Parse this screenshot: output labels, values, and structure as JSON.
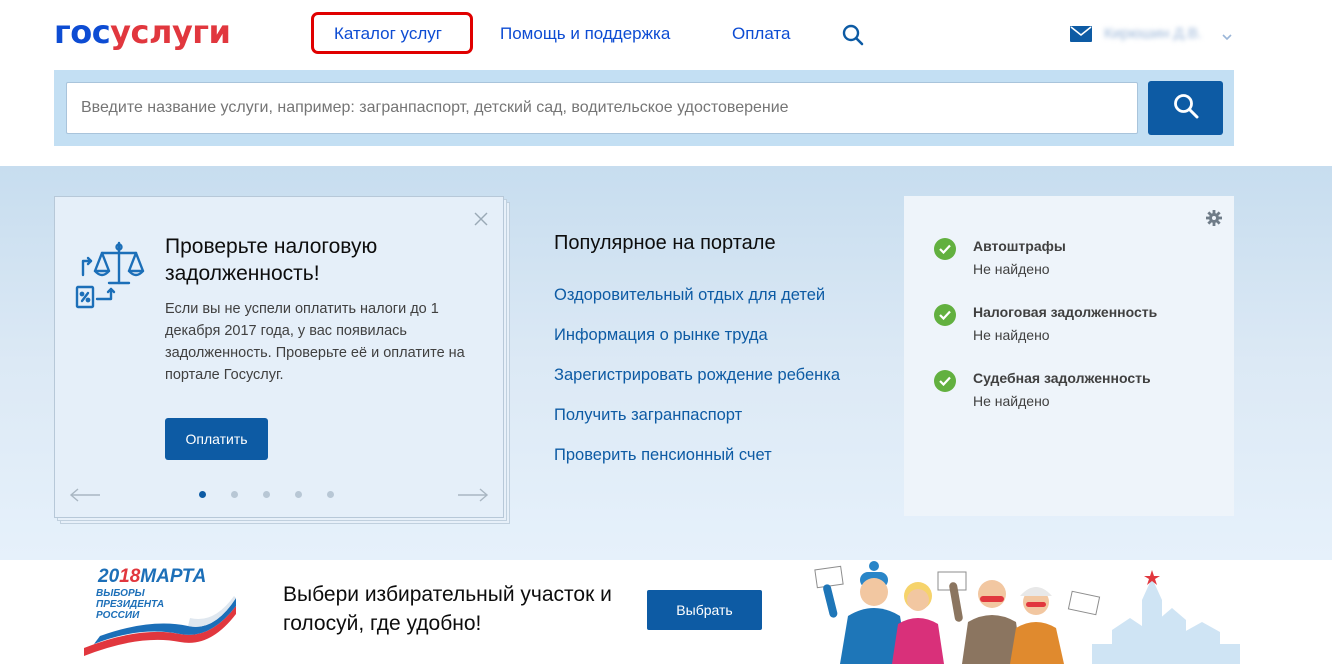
{
  "header": {
    "logo_part1": "гос",
    "logo_part2": "услуги",
    "nav": {
      "catalog": "Каталог услуг",
      "help": "Помощь и поддержка",
      "payment": "Оплата"
    },
    "user_name": "Кирюшин Д.В."
  },
  "search": {
    "placeholder": "Введите название услуги, например: загранпаспорт, детский сад, водительское удостоверение"
  },
  "promo_card": {
    "title": "Проверьте налоговую задолженность!",
    "text": "Если вы не успели оплатить налоги до 1 декабря 2017 года, у вас появилась задолженность. Проверьте её и оплатите на портале Госуслуг.",
    "button": "Оплатить",
    "slides_count": 5,
    "active_slide": 1
  },
  "popular": {
    "title": "Популярное на портале",
    "links": [
      "Оздоровительный отдых для детей",
      "Информация о рынке труда",
      "Зарегистрировать рождение ребенка",
      "Получить загранпаспорт",
      "Проверить пенсионный счет"
    ]
  },
  "status": {
    "items": [
      {
        "title": "Автоштрафы",
        "value": "Не найдено"
      },
      {
        "title": "Налоговая задолженность",
        "value": "Не найдено"
      },
      {
        "title": "Судебная задолженность",
        "value": "Не найдено"
      }
    ]
  },
  "banner": {
    "date_part1": "20",
    "date_part2": "18",
    "date_part3": "МАРТА",
    "subtitle": "ВЫБОРЫ ПРЕЗИДЕНТА РОССИИ",
    "text": "Выбери избирательный участок и голосуй, где удобно!",
    "button": "Выбрать"
  },
  "colors": {
    "brand_blue": "#0d4cd3",
    "brand_red": "#e1373e",
    "button_blue": "#0d5ba4",
    "success_green": "#62b03f",
    "highlight_red": "#e00000"
  }
}
